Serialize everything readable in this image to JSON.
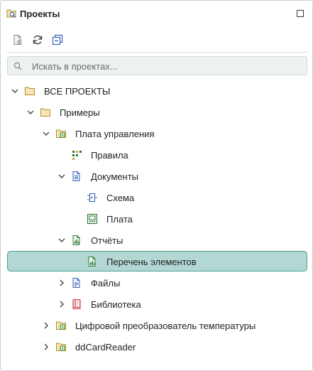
{
  "panel": {
    "title": "Проекты",
    "icons": {
      "title": "project-search-icon",
      "maximize": "maximize-icon"
    }
  },
  "toolbar": {
    "buttons": [
      {
        "name": "add-document-button",
        "icon": "document-add-icon"
      },
      {
        "name": "refresh-button",
        "icon": "refresh-icon"
      },
      {
        "name": "collapse-all-button",
        "icon": "collapse-all-icon"
      }
    ]
  },
  "search": {
    "placeholder": "Искать в проектах...",
    "value": ""
  },
  "tree": {
    "all_projects": "ВСЕ ПРОЕКТЫ",
    "examples": "Примеры",
    "control_board": "Плата управления",
    "rules": "Правила",
    "documents": "Документы",
    "scheme": "Схема",
    "board": "Плата",
    "reports": "Отчёты",
    "bom": "Перечень элементов",
    "files": "Файлы",
    "library": "Библиотека",
    "digital_converter": "Цифровой преобразователь температуры",
    "ddcardreader": "ddCardReader",
    "selected": "Перечень элементов"
  },
  "colors": {
    "selection_bg": "#b3d7d3",
    "selection_border": "#4aa096",
    "folder": "#c9a64a",
    "project": "#4a8a3a",
    "document": "#3b63b8",
    "report": "#2d7a3a",
    "library": "#c0393b"
  }
}
